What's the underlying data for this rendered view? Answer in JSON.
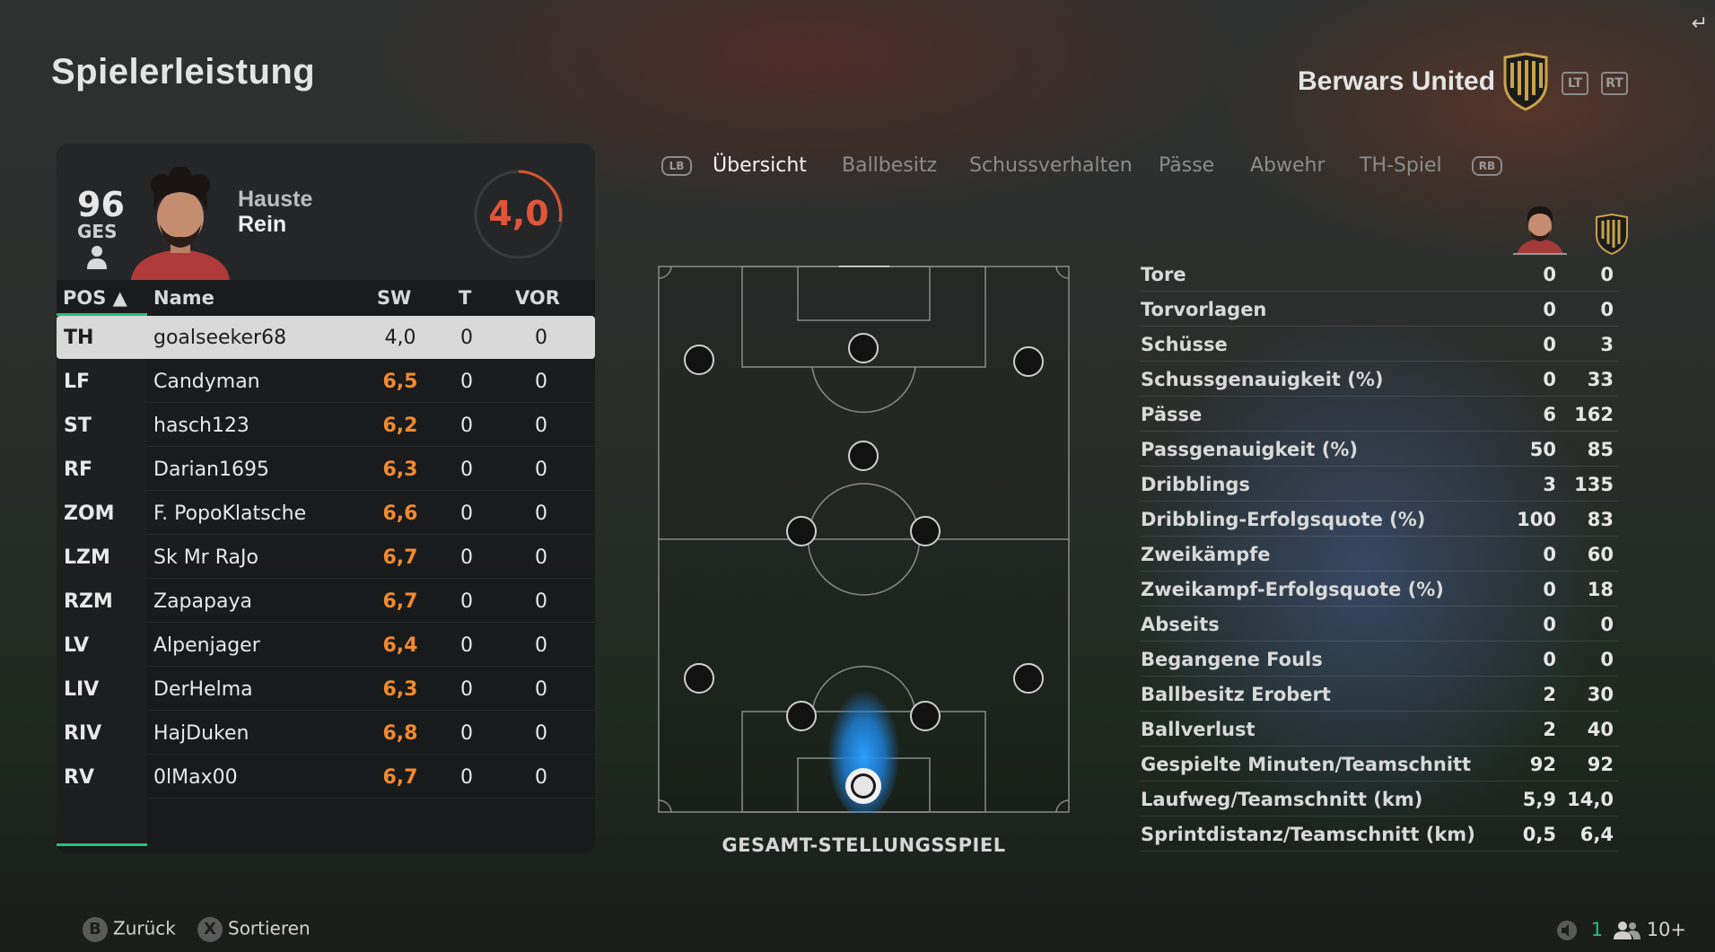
{
  "page": {
    "title": "Spielerleistung",
    "team_name": "Berwars United",
    "shoulder_left": "LT",
    "shoulder_right": "RT"
  },
  "player_card": {
    "overall": "96",
    "overall_label": "GES",
    "first_name": "Hauste",
    "last_name": "Rein",
    "match_rating": "4,0"
  },
  "table": {
    "headers": {
      "pos": "POS ▲",
      "name": "Name",
      "sw": "SW",
      "t": "T",
      "vor": "VOR"
    },
    "rows": [
      {
        "pos": "TH",
        "name": "goalseeker68",
        "sw": "4,0",
        "t": "0",
        "vor": "0"
      },
      {
        "pos": "LF",
        "name": "Candyman",
        "sw": "6,5",
        "t": "0",
        "vor": "0"
      },
      {
        "pos": "ST",
        "name": "hasch123",
        "sw": "6,2",
        "t": "0",
        "vor": "0"
      },
      {
        "pos": "RF",
        "name": "Darian1695",
        "sw": "6,3",
        "t": "0",
        "vor": "0"
      },
      {
        "pos": "ZOM",
        "name": "F. PopoKlatsche",
        "sw": "6,6",
        "t": "0",
        "vor": "0"
      },
      {
        "pos": "LZM",
        "name": "Sk Mr RaJo",
        "sw": "6,7",
        "t": "0",
        "vor": "0"
      },
      {
        "pos": "RZM",
        "name": "Zapapaya",
        "sw": "6,7",
        "t": "0",
        "vor": "0"
      },
      {
        "pos": "LV",
        "name": "Alpenjager",
        "sw": "6,4",
        "t": "0",
        "vor": "0"
      },
      {
        "pos": "LIV",
        "name": "DerHelma",
        "sw": "6,3",
        "t": "0",
        "vor": "0"
      },
      {
        "pos": "RIV",
        "name": "HajDuken",
        "sw": "6,8",
        "t": "0",
        "vor": "0"
      },
      {
        "pos": "RV",
        "name": "0lMax00",
        "sw": "6,7",
        "t": "0",
        "vor": "0"
      }
    ]
  },
  "tabs": {
    "hint_left": "LB",
    "hint_right": "RB",
    "items": [
      "Übersicht",
      "Ballbesitz",
      "Schussverhalten",
      "Pässe",
      "Abwehr",
      "TH-Spiel"
    ],
    "active": "Übersicht"
  },
  "pitch": {
    "title": "GESAMT-STELLUNGSSPIEL"
  },
  "stats": [
    {
      "label": "Tore",
      "player": "0",
      "team": "0"
    },
    {
      "label": "Torvorlagen",
      "player": "0",
      "team": "0"
    },
    {
      "label": "Schüsse",
      "player": "0",
      "team": "3"
    },
    {
      "label": "Schussgenauigkeit (%)",
      "player": "0",
      "team": "33"
    },
    {
      "label": "Pässe",
      "player": "6",
      "team": "162"
    },
    {
      "label": "Passgenauigkeit (%)",
      "player": "50",
      "team": "85"
    },
    {
      "label": "Dribblings",
      "player": "3",
      "team": "135"
    },
    {
      "label": "Dribbling-Erfolgsquote (%)",
      "player": "100",
      "team": "83"
    },
    {
      "label": "Zweikämpfe",
      "player": "0",
      "team": "60"
    },
    {
      "label": "Zweikampf-Erfolgsquote (%)",
      "player": "0",
      "team": "18"
    },
    {
      "label": "Abseits",
      "player": "0",
      "team": "0"
    },
    {
      "label": "Begangene Fouls",
      "player": "0",
      "team": "0"
    },
    {
      "label": "Ballbesitz Erobert",
      "player": "2",
      "team": "30"
    },
    {
      "label": "Ballverlust",
      "player": "2",
      "team": "40"
    },
    {
      "label": "Gespielte Minuten/Teamschnitt",
      "player": "92",
      "team": "92"
    },
    {
      "label": "Laufweg/Teamschnitt (km)",
      "player": "5,9",
      "team": "14,0"
    },
    {
      "label": "Sprintdistanz/Teamschnitt (km)",
      "player": "0,5",
      "team": "6,4"
    }
  ],
  "footer": {
    "back_key": "B",
    "back_label": "Zurück",
    "sort_key": "X",
    "sort_label": "Sortieren",
    "notif_count": "1",
    "players_count": "10+"
  },
  "colors": {
    "accent_green": "#27c07b",
    "rating_orange": "#f28a2e",
    "match_rating_red": "#e0553a",
    "heatmap_blue": "#1e8ae0"
  },
  "icons": [
    "exit-icon",
    "team-crest-icon",
    "person-icon",
    "player-avatar",
    "mute-icon",
    "players-icon"
  ]
}
